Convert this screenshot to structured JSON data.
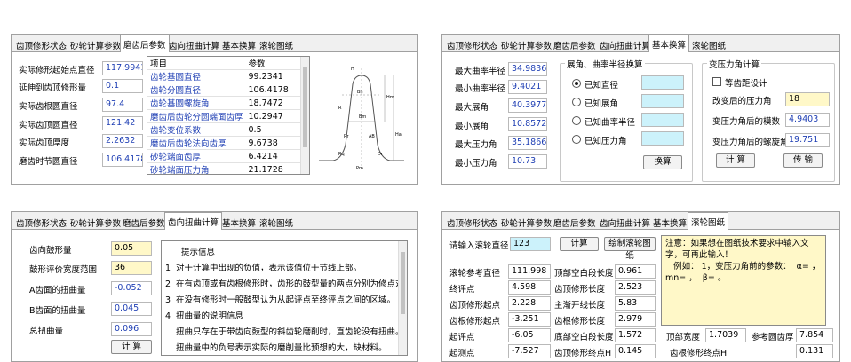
{
  "tabs": [
    "齿顶修形状态",
    "砂轮计算参数",
    "磨齿后参数",
    "齿向扭曲计算",
    "基本换算",
    "滚轮图纸"
  ],
  "p1": {
    "fields": [
      {
        "label": "实际修形起始点直径",
        "value": "117.9941"
      },
      {
        "label": "延伸到齿顶修形量",
        "value": "0.1"
      },
      {
        "label": "实际齿根圆直径",
        "value": "97.4"
      },
      {
        "label": "实际齿顶圆直径",
        "value": "121.42"
      },
      {
        "label": "实际齿顶厚度",
        "value": "2.2632"
      },
      {
        "label": "磨齿时节圆直径",
        "value": "106.4178"
      }
    ],
    "table": {
      "headers": [
        "项目",
        "参数"
      ],
      "rows": [
        [
          "齿轮基圆直径",
          "99.2341"
        ],
        [
          "齿轮分圆直径",
          "106.4178"
        ],
        [
          "齿轮基圆螺旋角",
          "18.7472"
        ],
        [
          "磨齿后齿轮分圆端面齿厚",
          "10.2947"
        ],
        [
          "齿轮变位系数",
          "0.5"
        ],
        [
          "磨齿后齿轮法向齿厚",
          "9.6738"
        ],
        [
          "砂轮端面齿厚",
          "6.4214"
        ],
        [
          "砂轮端面压力角",
          "21.1728"
        ]
      ]
    },
    "diagram_labels": {
      "h": "H",
      "ha": "Ha",
      "hm": "Hm",
      "bm": "Bm",
      "bh": "Bh",
      "dr": "Dr",
      "rr": "R",
      "rq": "Rq",
      "pm": "Pm",
      "ab": "AB",
      "rr2": "Rr"
    }
  },
  "p2": {
    "left": [
      {
        "label": "最大曲率半径",
        "value": "34.9836"
      },
      {
        "label": "最小曲率半径",
        "value": "9.4021"
      },
      {
        "label": "最大展角",
        "value": "40.3977"
      },
      {
        "label": "最小展角",
        "value": "10.8572"
      },
      {
        "label": "最大压力角",
        "value": "35.1866"
      },
      {
        "label": "最小压力角",
        "value": "10.73"
      }
    ],
    "group1_title": "展角、曲率半径换算",
    "radios": [
      "已知直径",
      "已知展角",
      "已知曲率半径",
      "已知压力角"
    ],
    "calc1": "换算",
    "group2_title": "变压力角计算",
    "checkbox": "等齿距设计",
    "g2_fields": [
      {
        "label": "改变后的压力角",
        "value": "18"
      },
      {
        "label": "变压力角后的模数",
        "value": "4.9403"
      },
      {
        "label": "变压力角后的螺旋角",
        "value": "19.751"
      }
    ],
    "calc2": "计 算",
    "send": "传 输"
  },
  "p3": {
    "fields": [
      {
        "label": "齿向鼓形量",
        "value": "0.05"
      },
      {
        "label": "鼓形评价宽度范围",
        "value": "36"
      },
      {
        "label": "A齿面的扭曲量",
        "value": "-0.052"
      },
      {
        "label": "B齿面的扭曲量",
        "value": "0.045"
      },
      {
        "label": "总扭曲量",
        "value": "0.096"
      }
    ],
    "calc": "计 算",
    "info_title": "提示信息",
    "info": [
      {
        "n": "1",
        "t": "对于计算中出现的负值，表示该值位于节线上部。"
      },
      {
        "n": "2",
        "t": "在有齿顶或有齿根修形时，齿形的鼓型量的两点分别为修点对应。"
      },
      {
        "n": "3",
        "t": "在没有修形时一般鼓型认为从起评点至终评点之间的区域。"
      },
      {
        "n": "4",
        "t": "扭曲量的说明信息"
      },
      {
        "n": "",
        "t": "扭曲只存在于带齿向鼓型的斜齿轮磨削时，直齿轮没有扭曲。"
      },
      {
        "n": "",
        "t": "扭曲量中的负号表示实际的磨削量比预想的大，缺材料。"
      }
    ]
  },
  "p4": {
    "input_label": "请输入滚轮直径",
    "input_value": "123",
    "calc": "计算",
    "draw": "绘制滚轮图纸",
    "note": "注意：如果想在图纸技术要求中输入文字，可再此输入！\n   例如： 1，变压力角前的参数：  α= ，  mn= ，  β= 。",
    "left": [
      {
        "label": "滚轮参考直径",
        "value": "111.998"
      },
      {
        "label": "终评点",
        "value": "4.598"
      },
      {
        "label": "齿顶修形起点",
        "value": "2.228"
      },
      {
        "label": "齿根修形起点",
        "value": "-3.251"
      },
      {
        "label": "起评点",
        "value": "-6.05"
      },
      {
        "label": "起测点",
        "value": "-7.527"
      }
    ],
    "mid": [
      {
        "label": "顶部空白段长度",
        "value": "0.961"
      },
      {
        "label": "齿顶修形长度",
        "value": "2.523"
      },
      {
        "label": "主渐开线长度",
        "value": "5.83"
      },
      {
        "label": "齿根修形长度",
        "value": "2.979"
      },
      {
        "label": "底部空白段长度",
        "value": "1.572"
      },
      {
        "label": "齿顶修形终点H",
        "value": "0.145"
      }
    ],
    "right": [
      {
        "label": "顶部宽度",
        "value": "1.7039"
      },
      {
        "label": "参考圆齿厚",
        "value": "7.854"
      },
      {
        "label": "齿根修形终点H",
        "value": "0.131"
      }
    ]
  }
}
